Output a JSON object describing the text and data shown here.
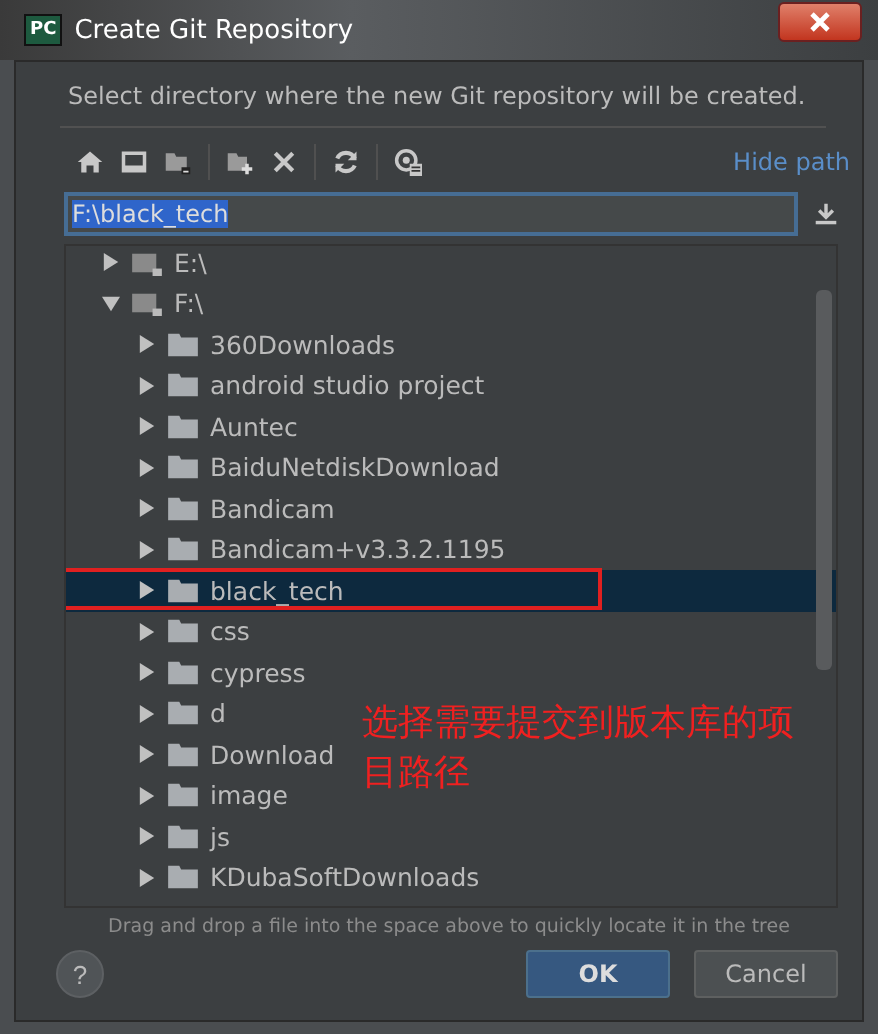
{
  "window": {
    "title": "Create Git Repository",
    "app_badge": "PC"
  },
  "description": "Select directory where the new Git repository will be created.",
  "toolbar": {
    "hide_path_link": "Hide path"
  },
  "path_field": {
    "value": "F:\\black_tech",
    "text_selected": true
  },
  "tree": {
    "items": [
      {
        "label": "E:\\",
        "kind": "drive",
        "expanded": false,
        "selected": false,
        "marked": false
      },
      {
        "label": "F:\\",
        "kind": "drive",
        "expanded": true,
        "selected": false,
        "marked": false,
        "children": [
          {
            "label": "360Downloads",
            "kind": "folder",
            "expanded": false,
            "selected": false,
            "marked": false
          },
          {
            "label": "android studio project",
            "kind": "folder",
            "expanded": false,
            "selected": false,
            "marked": false
          },
          {
            "label": "Auntec",
            "kind": "folder",
            "expanded": false,
            "selected": false,
            "marked": false
          },
          {
            "label": "BaiduNetdiskDownload",
            "kind": "folder",
            "expanded": false,
            "selected": false,
            "marked": false
          },
          {
            "label": "Bandicam",
            "kind": "folder",
            "expanded": false,
            "selected": false,
            "marked": false
          },
          {
            "label": "Bandicam+v3.3.2.1195",
            "kind": "folder",
            "expanded": false,
            "selected": false,
            "marked": false
          },
          {
            "label": "black_tech",
            "kind": "folder",
            "expanded": false,
            "selected": true,
            "marked": true
          },
          {
            "label": "css",
            "kind": "folder",
            "expanded": false,
            "selected": false,
            "marked": false
          },
          {
            "label": "cypress",
            "kind": "folder",
            "expanded": false,
            "selected": false,
            "marked": false
          },
          {
            "label": "d",
            "kind": "folder",
            "expanded": false,
            "selected": false,
            "marked": false
          },
          {
            "label": "Download",
            "kind": "folder",
            "expanded": false,
            "selected": false,
            "marked": false
          },
          {
            "label": "image",
            "kind": "folder",
            "expanded": false,
            "selected": false,
            "marked": false
          },
          {
            "label": "js",
            "kind": "folder",
            "expanded": false,
            "selected": false,
            "marked": false
          },
          {
            "label": "KDubaSoftDownloads",
            "kind": "folder",
            "expanded": false,
            "selected": false,
            "marked": false
          }
        ]
      }
    ]
  },
  "annotation": {
    "text": "选择需要提交到版本库的项目路径"
  },
  "hint": "Drag and drop a file into the space above to quickly locate it in the tree",
  "help_button": "?",
  "buttons": [
    {
      "label": "OK",
      "kind": "primary"
    },
    {
      "label": "Cancel",
      "kind": "secondary"
    }
  ]
}
